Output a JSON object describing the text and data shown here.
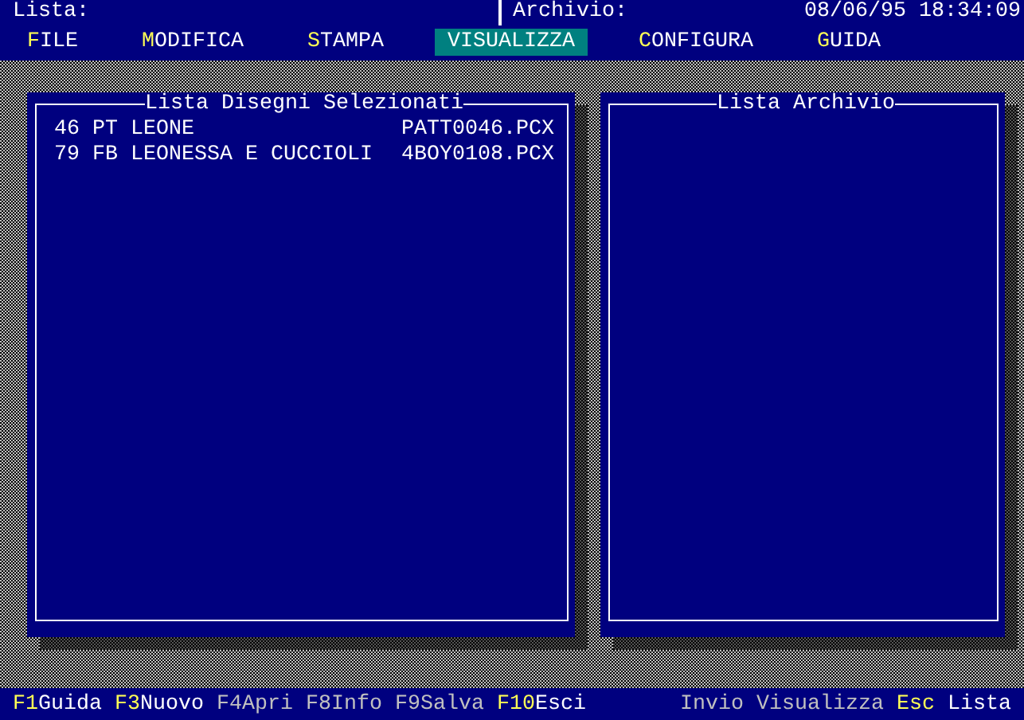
{
  "header": {
    "list_label": "Lista:",
    "archive_label": "Archivio:",
    "datetime": "08/06/95 18:34:09"
  },
  "menu": [
    {
      "label": "FILE",
      "selected": false
    },
    {
      "label": "MODIFICA",
      "selected": false
    },
    {
      "label": "STAMPA",
      "selected": false
    },
    {
      "label": "VISUALIZZA",
      "selected": true
    },
    {
      "label": "CONFIGURA",
      "selected": false
    },
    {
      "label": "GUIDA",
      "selected": false
    }
  ],
  "panels": [
    {
      "title": "Lista Disegni Selezionati",
      "rows": [
        {
          "number": "46",
          "code": "PT",
          "name": "LEONE",
          "file": "PATT0046.PCX"
        },
        {
          "number": "79",
          "code": "FB",
          "name": "LEONESSA E CUCCIOLI",
          "file": "4BOY0108.PCX"
        }
      ]
    },
    {
      "title": "Lista Archivio"
    }
  ],
  "function_keys": [
    {
      "key": "F1",
      "action": "Guida",
      "disabled": false
    },
    {
      "key": "F3",
      "action": "Nuovo",
      "disabled": false
    },
    {
      "key": "F4",
      "action": "Apri",
      "disabled": true
    },
    {
      "key": "F8",
      "action": "Info",
      "disabled": true
    },
    {
      "key": "F9",
      "action": "Salva",
      "disabled": true
    },
    {
      "key": "F10",
      "action": "Esci",
      "disabled": false
    }
  ],
  "hints": [
    {
      "key": "Invio",
      "action": "Visualizza",
      "disabled": true
    },
    {
      "key": "Esc",
      "action": "Lista",
      "disabled": false
    }
  ]
}
